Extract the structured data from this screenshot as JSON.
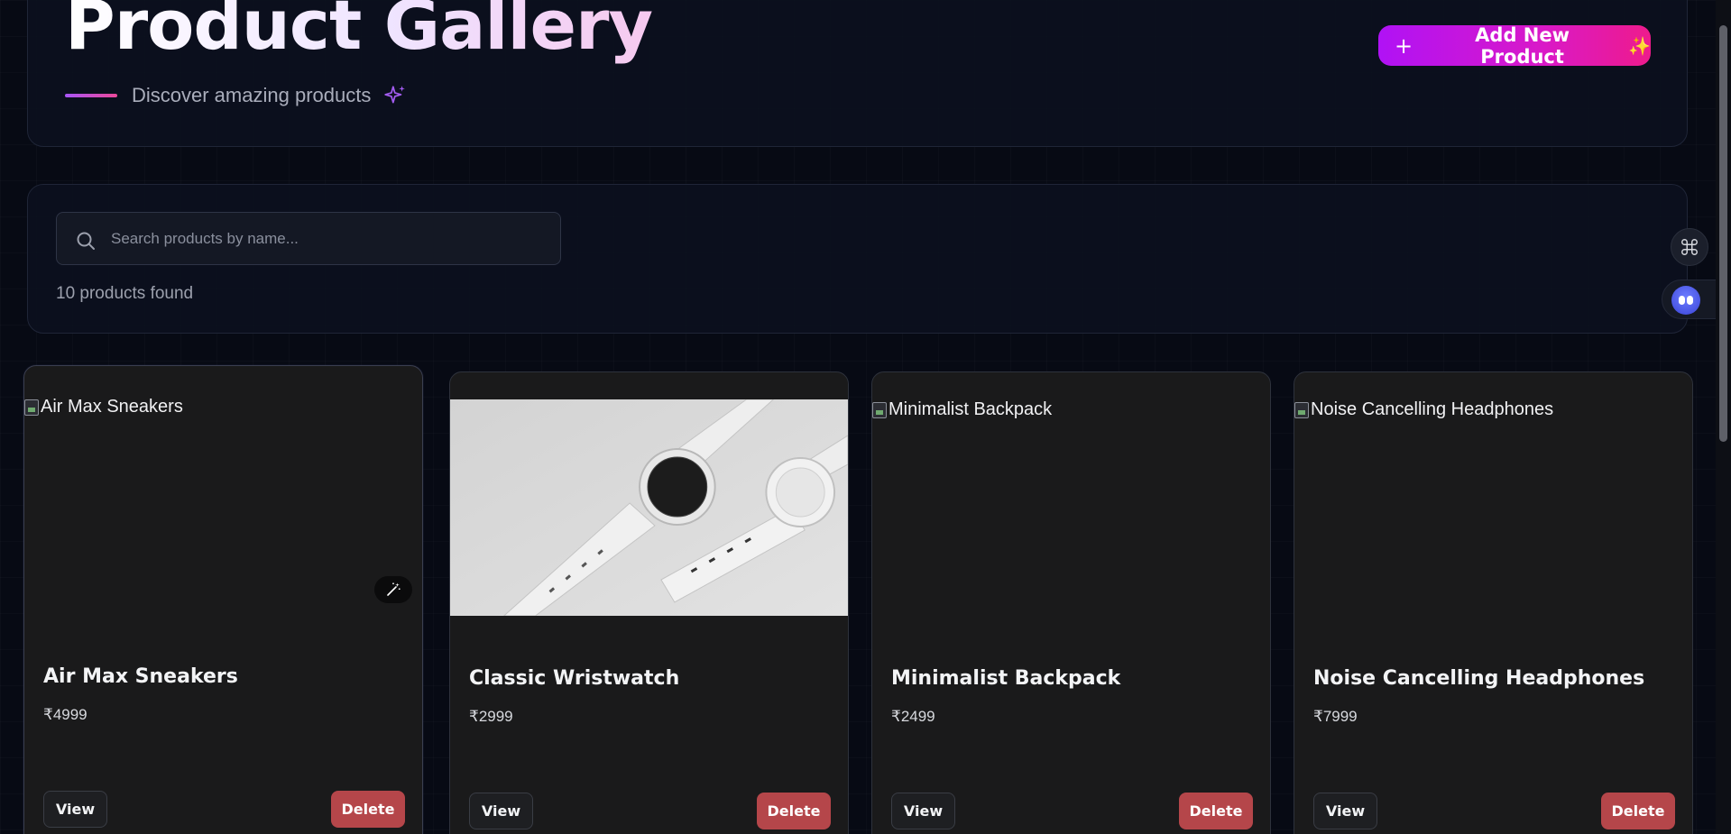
{
  "header": {
    "title": "Product Gallery",
    "subtitle": "Discover amazing products",
    "add_button_label": "Add New Product",
    "add_button_plus": "+",
    "add_button_sparkle": "✨"
  },
  "search": {
    "placeholder": "Search products by name...",
    "value": "",
    "results_text": "10 products found"
  },
  "products": [
    {
      "name": "Air Max Sneakers",
      "price": "₹4999",
      "image_alt": "Air Max Sneakers",
      "image_loaded": false,
      "view_label": "View",
      "delete_label": "Delete"
    },
    {
      "name": "Classic Wristwatch",
      "price": "₹2999",
      "image_alt": "Classic Wristwatch",
      "image_loaded": true,
      "view_label": "View",
      "delete_label": "Delete"
    },
    {
      "name": "Minimalist Backpack",
      "price": "₹2499",
      "image_alt": "Minimalist Backpack",
      "image_loaded": false,
      "view_label": "View",
      "delete_label": "Delete"
    },
    {
      "name": "Noise Cancelling Headphones",
      "price": "₹7999",
      "image_alt": "Noise Cancelling Headphones",
      "image_loaded": false,
      "view_label": "View",
      "delete_label": "Delete"
    }
  ],
  "icons": {
    "subtitle": "sparkles-icon",
    "search": "search-icon",
    "floating_command": "command-icon",
    "floating_assistant": "assistant-bot-icon",
    "card_badge": "magic-wand-icon"
  },
  "colors": {
    "background": "#070a14",
    "accent_gradient_start": "#b012f5",
    "accent_gradient_end": "#ee1b8c",
    "delete": "#b5464a",
    "card": "#1a1a1b"
  }
}
